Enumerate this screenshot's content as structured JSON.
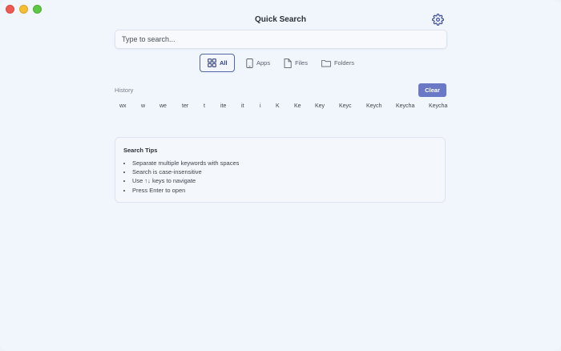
{
  "window": {
    "title": "Quick Search"
  },
  "search": {
    "placeholder": "Type to search...",
    "value": ""
  },
  "filters": [
    {
      "label": "All",
      "icon": "grid-icon",
      "active": true
    },
    {
      "label": "Apps",
      "icon": "phone-icon",
      "active": false
    },
    {
      "label": "Files",
      "icon": "file-icon",
      "active": false
    },
    {
      "label": "Folders",
      "icon": "folder-icon",
      "active": false
    }
  ],
  "history": {
    "label": "History",
    "clear_label": "Clear",
    "items": [
      "wx",
      "w",
      "we",
      "ter",
      "t",
      "ite",
      "it",
      "i",
      "K",
      "Ke",
      "Key",
      "Keyc",
      "Keych",
      "Keycha",
      "Keycha"
    ]
  },
  "tips": {
    "title": "Search Tips",
    "items": [
      "Separate multiple keywords with spaces",
      "Search is case-insensitive",
      "Use ↑↓ keys to navigate",
      "Press Enter to open"
    ]
  },
  "colors": {
    "accent": "#6a79c6",
    "active_border": "#5466a8",
    "background": "#f1f5fc"
  }
}
